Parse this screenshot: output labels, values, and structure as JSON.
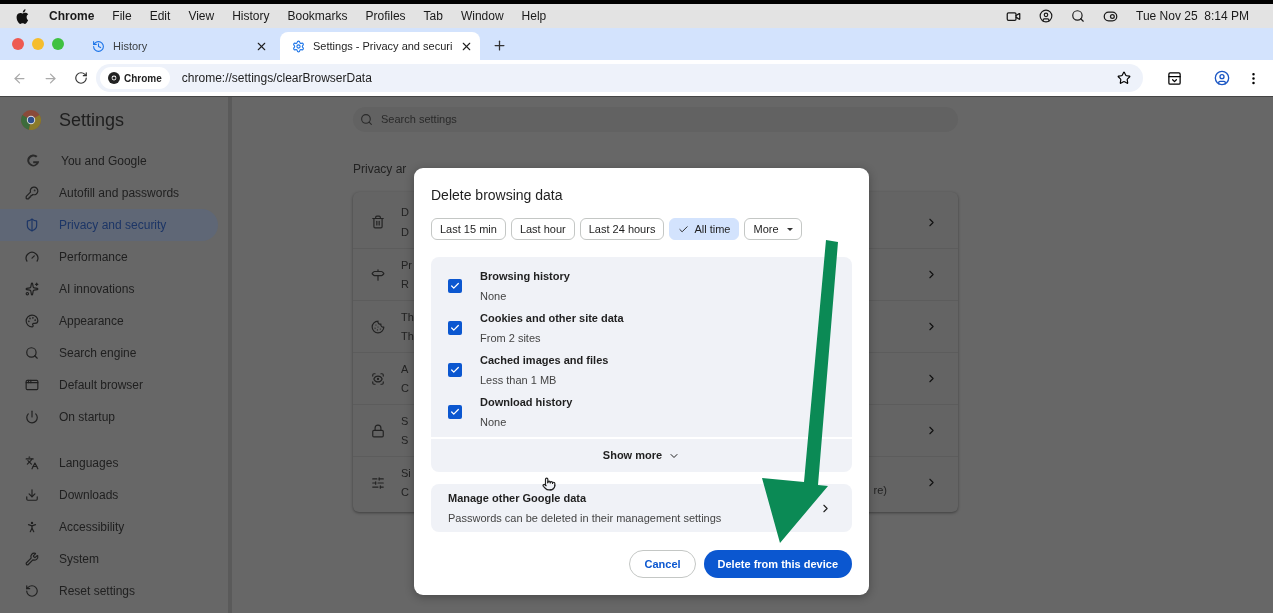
{
  "menu_bar": {
    "app": "Chrome",
    "items": [
      "File",
      "Edit",
      "View",
      "History",
      "Bookmarks",
      "Profiles",
      "Tab",
      "Window",
      "Help"
    ],
    "clock": "Tue Nov 25  8:14 PM"
  },
  "tabs": [
    {
      "title": "History",
      "selected": false
    },
    {
      "title": "Settings - Privacy and securi",
      "selected": true
    }
  ],
  "address_bar": {
    "chip": "Chrome",
    "url": "chrome://settings/clearBrowserData"
  },
  "settings": {
    "title": "Settings",
    "search_placeholder": "Search settings",
    "nav_groups": [
      [
        {
          "label": "You and Google",
          "selected": false
        },
        {
          "label": "Autofill and passwords",
          "selected": false
        },
        {
          "label": "Privacy and security",
          "selected": true
        },
        {
          "label": "Performance",
          "selected": false
        },
        {
          "label": "AI innovations",
          "selected": false
        },
        {
          "label": "Appearance",
          "selected": false
        },
        {
          "label": "Search engine",
          "selected": false
        },
        {
          "label": "Default browser",
          "selected": false
        },
        {
          "label": "On startup",
          "selected": false
        }
      ],
      [
        {
          "label": "Languages",
          "selected": false
        },
        {
          "label": "Downloads",
          "selected": false
        },
        {
          "label": "Accessibility",
          "selected": false
        },
        {
          "label": "System",
          "selected": false
        },
        {
          "label": "Reset settings",
          "selected": false
        }
      ]
    ],
    "section_heading": "Privacy ar",
    "rows": [
      {
        "title": "D",
        "subtitle": "D"
      },
      {
        "title": "Pr",
        "subtitle": "R"
      },
      {
        "title": "Th",
        "subtitle": "Th"
      },
      {
        "title": "A",
        "subtitle": "C"
      },
      {
        "title": "S",
        "subtitle": "S"
      },
      {
        "title": "Si",
        "subtitle": "C",
        "tail": "re)"
      }
    ]
  },
  "dialog": {
    "title": "Delete browsing data",
    "ranges": [
      {
        "label": "Last 15 min",
        "selected": false
      },
      {
        "label": "Last hour",
        "selected": false
      },
      {
        "label": "Last 24 hours",
        "selected": false
      },
      {
        "label": "All time",
        "selected": true
      }
    ],
    "more": "More",
    "items": [
      {
        "title": "Browsing history",
        "detail": "None",
        "checked": true
      },
      {
        "title": "Cookies and other site data",
        "detail": "From 2 sites",
        "checked": true
      },
      {
        "title": "Cached images and files",
        "detail": "Less than 1 MB",
        "checked": true
      },
      {
        "title": "Download history",
        "detail": "None",
        "checked": true
      }
    ],
    "show_more": "Show more",
    "manage": {
      "title": "Manage other Google data",
      "subtitle": "Passwords can be deleted in their management settings"
    },
    "cancel": "Cancel",
    "confirm": "Delete from this device"
  }
}
